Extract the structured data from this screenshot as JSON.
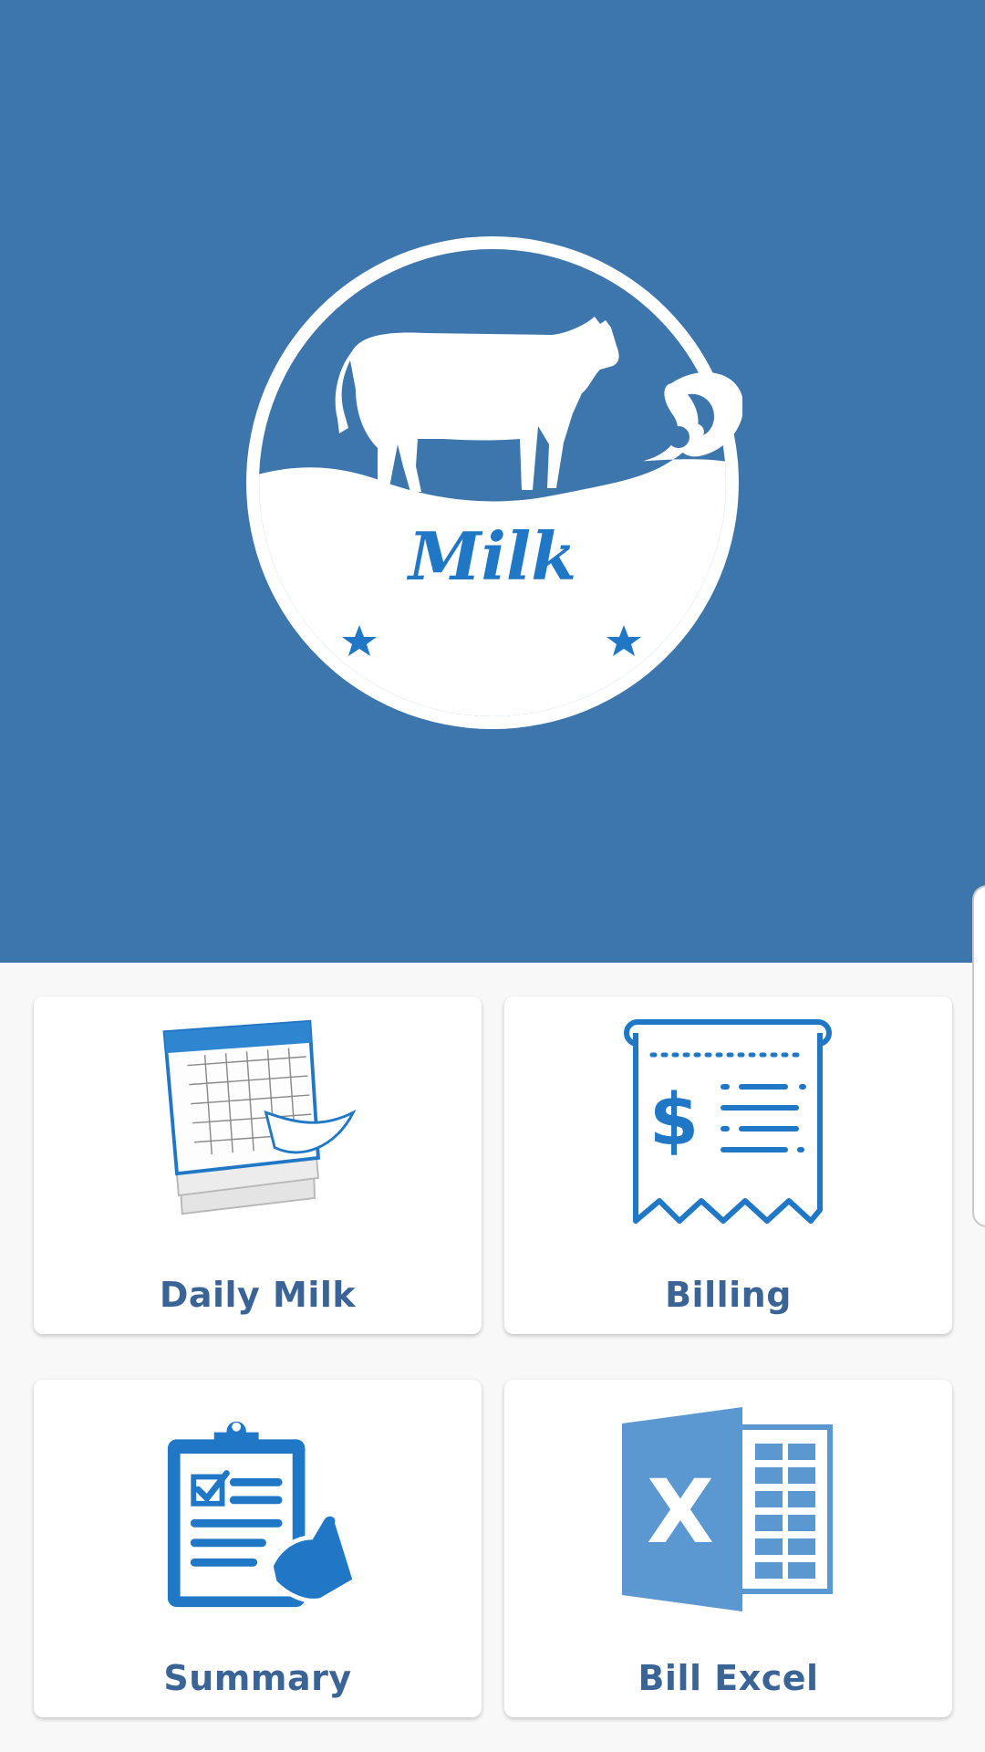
{
  "logo": {
    "text": "Milk",
    "icon": "cow-milk-logo"
  },
  "colors": {
    "header_bg": "#3d76ad",
    "accent": "#1f77c6",
    "label": "#3b6496",
    "excel": "#5b97d1"
  },
  "menu": [
    {
      "label": "Daily Milk",
      "icon": "calendar-icon"
    },
    {
      "label": "Billing",
      "icon": "receipt-icon"
    },
    {
      "label": "Summary",
      "icon": "clipboard-checklist-icon"
    },
    {
      "label": "Bill Excel",
      "icon": "excel-icon"
    }
  ]
}
